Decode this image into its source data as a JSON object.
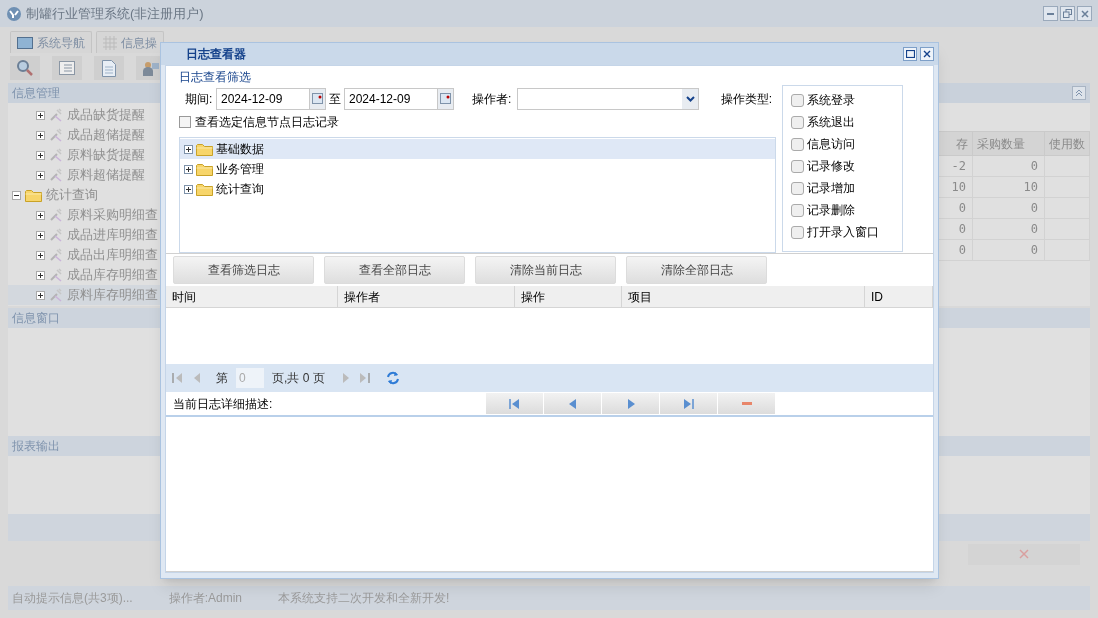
{
  "window": {
    "title": "制罐行业管理系统(非注册用户)"
  },
  "tabs": [
    {
      "label": "系统导航",
      "selected": false
    },
    {
      "label": "信息操",
      "selected": false
    }
  ],
  "sidebar": {
    "sections": [
      {
        "title": "信息管理",
        "items": [
          {
            "label": "成品缺货提醒",
            "expanded": false,
            "selected": false
          },
          {
            "label": "成品超储提醒",
            "expanded": false,
            "selected": false
          },
          {
            "label": "原料缺货提醒",
            "expanded": false,
            "selected": false
          },
          {
            "label": "原料超储提醒",
            "expanded": false,
            "selected": false
          },
          {
            "label": "统计查询",
            "kind": "folder",
            "expanded": true,
            "selected": false,
            "children": [
              {
                "label": "原料采购明细查",
                "expanded": false,
                "selected": false
              },
              {
                "label": "成品进库明细查",
                "expanded": false,
                "selected": false
              },
              {
                "label": "成品出库明细查",
                "expanded": false,
                "selected": false
              },
              {
                "label": "成品库存明细查",
                "expanded": false,
                "selected": false
              },
              {
                "label": "原料库存明细查",
                "expanded": false,
                "selected": true
              }
            ]
          }
        ]
      },
      {
        "title": "信息窗口"
      },
      {
        "title": "报表输出"
      }
    ]
  },
  "stock_table": {
    "columns": [
      "存",
      "采购数量",
      "使用数"
    ],
    "rows": [
      [
        "-2",
        "0"
      ],
      [
        "10",
        "10"
      ],
      [
        "0",
        "0"
      ],
      [
        "0",
        "0"
      ],
      [
        "0",
        "0"
      ]
    ]
  },
  "status_bar": [
    "自动提示信息(共3项)...",
    "操作者:Admin",
    "本系统支持二次开发和全新开发!"
  ],
  "dialog": {
    "title": "日志查看器",
    "filter_title": "日志查看筛选",
    "period_label": "期间:",
    "date_from": "2024-12-09",
    "to_label": "至",
    "date_to": "2024-12-09",
    "operator_label": "操作者:",
    "type_label": "操作类型:",
    "types": [
      {
        "label": "系统登录",
        "checked": false
      },
      {
        "label": "系统退出",
        "checked": false
      },
      {
        "label": "信息访问",
        "checked": false
      },
      {
        "label": "记录修改",
        "checked": false
      },
      {
        "label": "记录增加",
        "checked": false
      },
      {
        "label": "记录删除",
        "checked": false
      },
      {
        "label": "打开录入窗口",
        "checked": false
      }
    ],
    "node_filter": {
      "label": "查看选定信息节点日志记录",
      "checked": false
    },
    "tree": [
      {
        "label": "基础数据",
        "expanded": false,
        "selected": true
      },
      {
        "label": "业务管理",
        "expanded": false,
        "selected": false
      },
      {
        "label": "统计查询",
        "expanded": false,
        "selected": false
      }
    ],
    "buttons": [
      "查看筛选日志",
      "查看全部日志",
      "清除当前日志",
      "清除全部日志"
    ],
    "log_columns": [
      "时间",
      "操作者",
      "操作",
      "项目",
      "ID"
    ],
    "pager": {
      "page_label": "第",
      "page": "0",
      "total": "页,共 0 页"
    },
    "detail_label": "当前日志详细描述:"
  }
}
